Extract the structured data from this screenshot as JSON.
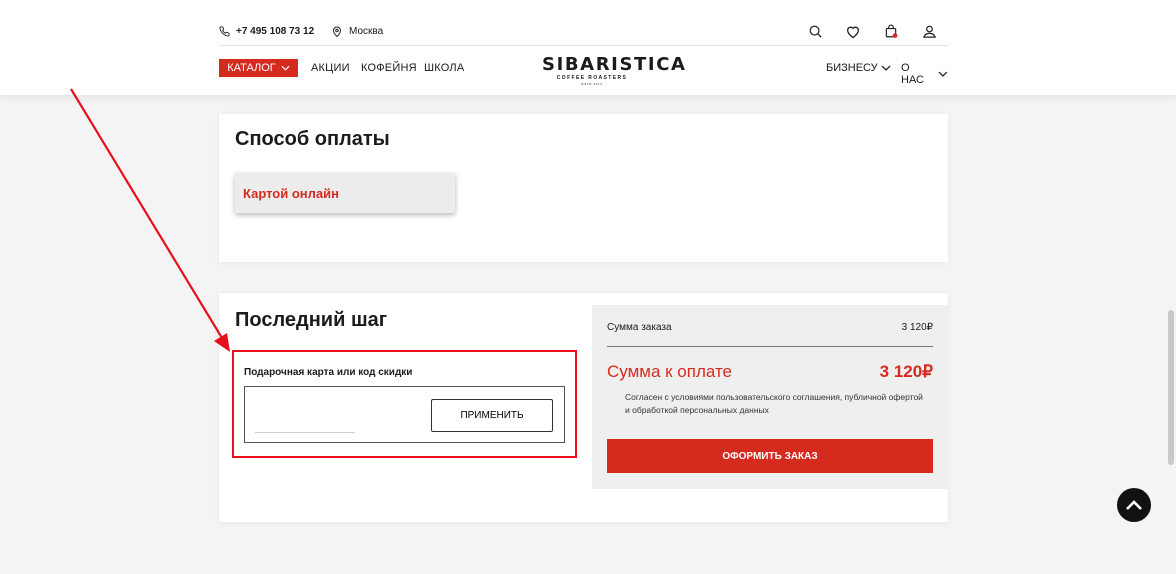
{
  "header": {
    "phone": "+7 495 108 73 12",
    "city": "Москва",
    "icons": [
      "search-icon",
      "heart-icon",
      "cart-icon",
      "user-icon"
    ],
    "catalog_label": "КАТАЛОГ",
    "nav_links": [
      "АКЦИИ",
      "КОФЕЙНЯ",
      "ШКОЛА"
    ],
    "logo_main": "SIBARISTICA",
    "logo_sub": "COFFEE ROASTERS",
    "logo_est": "ESTD 2014",
    "nav_right": [
      "БИЗНЕСУ",
      "О НАС"
    ]
  },
  "payment": {
    "title": "Способ оплаты",
    "option": "Картой онлайн"
  },
  "last_step": {
    "title": "Последний шаг",
    "promo_label": "Подарочная карта или код скидки",
    "promo_value": "",
    "promo_placeholder": "",
    "apply_label": "ПРИМЕНИТЬ",
    "summary": {
      "order_sum_label": "Сумма заказа",
      "order_sum_value": "3 120₽",
      "pay_label": "Сумма к оплате",
      "pay_value": "3 120₽",
      "agreement": "Согласен с условиями пользовательского соглашения, публичной офертой и обработкой персональных данных",
      "order_button": "ОФОРМИТЬ ЗАКАЗ"
    }
  },
  "colors": {
    "accent": "#d52b1e",
    "annotation": "#e8101a"
  }
}
